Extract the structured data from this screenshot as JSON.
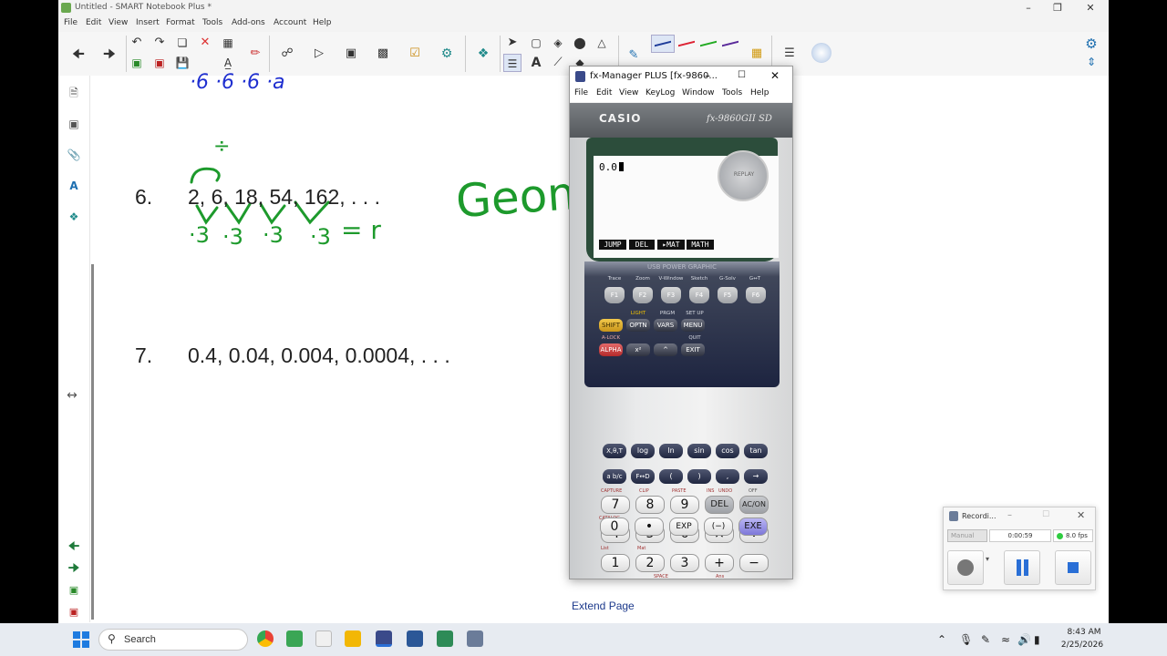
{
  "window": {
    "title": "Untitled - SMART Notebook Plus *"
  },
  "menu": [
    "File",
    "Edit",
    "View",
    "Insert",
    "Format",
    "Tools",
    "Add-ons",
    "Account",
    "Help"
  ],
  "page": {
    "q6_number": "6.",
    "q6_sequence": "2, 6, 18, 54, 162, . . .",
    "q7_number": "7.",
    "q7_sequence": "0.4, 0.04, 0.004, 0.0004, . . .",
    "ink_top": "·6  ·6  ·6  ·a",
    "ink_division": "÷",
    "ink_geometric": "Geome",
    "ink_ratio_1": "·3",
    "ink_ratio_2": "·3",
    "ink_ratio_3": "·3",
    "ink_ratio_4": "·3",
    "ink_equals_r": "= r",
    "extend_page": "Extend Page"
  },
  "fx": {
    "title": "fx-Manager PLUS [fx-9860...",
    "menu": [
      "File",
      "Edit",
      "View",
      "KeyLog",
      "Window",
      "Tools",
      "Help"
    ],
    "brand": "CASIO",
    "model": "fx-9860GII SD",
    "display_value": "0.0",
    "softkeys": [
      "JUMP",
      "DEL",
      "▸MAT",
      "MATH"
    ],
    "usb_label": "USB POWER GRAPHIC",
    "f_labels": [
      "Trace",
      "Zoom",
      "V-Window",
      "Sketch",
      "G-Solv",
      "G↔T"
    ],
    "f_keys": [
      "F1",
      "F2",
      "F3",
      "F4",
      "F5",
      "F6"
    ],
    "light": "LIGHT",
    "prgm": "PRGM",
    "setup": "SET UP",
    "shift": "SHIFT",
    "optn": "OPTN",
    "vars": "VARS",
    "menu_key": "MENU",
    "replay": "REPLAY",
    "alock": "A-LOCK",
    "quit": "QUIT",
    "alpha": "ALPHA",
    "x2": "x²",
    "caret": "^",
    "exit": "EXIT",
    "row_fn": [
      "X,θ,T",
      "log",
      "ln",
      "sin",
      "cos",
      "tan"
    ],
    "row_frac": [
      "a b/c",
      "F↔D",
      "(",
      ")",
      ",",
      "→"
    ],
    "labels_capture": [
      "CAPTURE",
      "CLIP",
      "PASTE",
      "INS",
      "UNDO",
      "OFF"
    ],
    "row_num1": [
      "7",
      "8",
      "9",
      "DEL",
      "AC/ON"
    ],
    "labels_catalog": [
      "CATALOG"
    ],
    "row_num2": [
      "4",
      "5",
      "6",
      "×",
      "÷"
    ],
    "labels_list": [
      "List",
      "Mat"
    ],
    "row_num3": [
      "1",
      "2",
      "3",
      "+",
      "−"
    ],
    "labels_space": [
      "SPACE",
      "Ans"
    ],
    "row_num4": [
      "0",
      "•",
      "EXP",
      "(−)",
      "EXE"
    ]
  },
  "recorder": {
    "title": "Recordi...",
    "mode": "Manual",
    "time": "0:00:59",
    "fps": "8.0 fps"
  },
  "taskbar": {
    "search_placeholder": "Search",
    "time": "8:43 AM",
    "date": "2/25/2026"
  },
  "colors": {
    "ink_blue": "#1f2fd0",
    "ink_green": "#1d9a2c",
    "accent_blue": "#1e6fb0",
    "recording_dot": "#2ecc40"
  }
}
